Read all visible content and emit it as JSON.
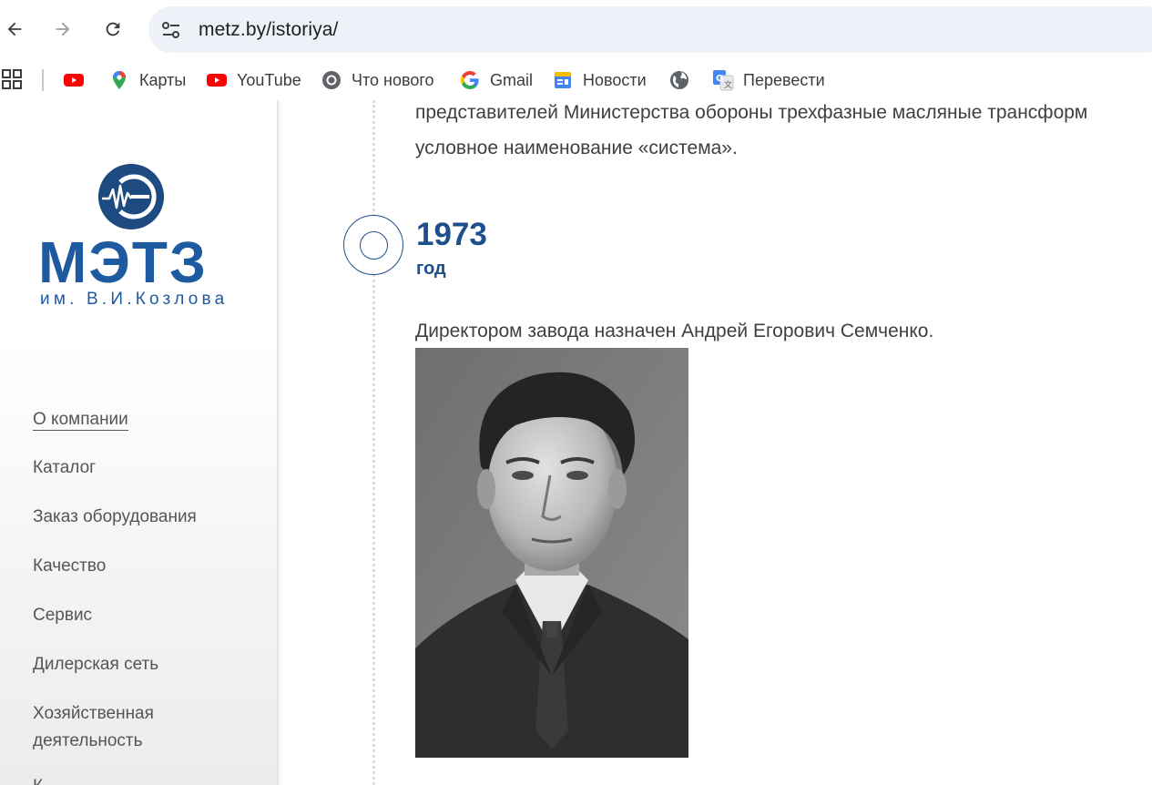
{
  "browser": {
    "url": "metz.by/istoriya/",
    "bookmarks": [
      {
        "label": "",
        "icon": "youtube-icon"
      },
      {
        "label": "Карты",
        "icon": "maps-pin-icon"
      },
      {
        "label": "YouTube",
        "icon": "youtube-icon"
      },
      {
        "label": "Что нового",
        "icon": "chrome-icon"
      },
      {
        "label": "Gmail",
        "icon": "google-g-icon"
      },
      {
        "label": "Новости",
        "icon": "google-news-icon"
      },
      {
        "label": "",
        "icon": "globe-icon"
      },
      {
        "label": "Перевести",
        "icon": "google-translate-icon"
      }
    ]
  },
  "logo": {
    "name": "МЭТЗ",
    "subtitle": "им. В.И.Козлова",
    "brand_color": "#1e5a9f"
  },
  "sidebar": {
    "menu": [
      {
        "label": "О компании",
        "active": true
      },
      {
        "label": "Каталог"
      },
      {
        "label": "Заказ оборудования"
      },
      {
        "label": "Качество"
      },
      {
        "label": "Сервис"
      },
      {
        "label": "Дилерская сеть"
      },
      {
        "label": "Хозяйственная"
      },
      {
        "label": "деятельность"
      },
      {
        "label": "К..."
      }
    ]
  },
  "content": {
    "intro_line1": "представителей Министерства обороны трехфазные масляные трансформ",
    "intro_line2": "условное наименование «система».",
    "year": "1973",
    "year_unit": "год",
    "text": "Директором завода назначен Андрей Егорович Семченко.",
    "accent_color": "#1d4f8c"
  }
}
